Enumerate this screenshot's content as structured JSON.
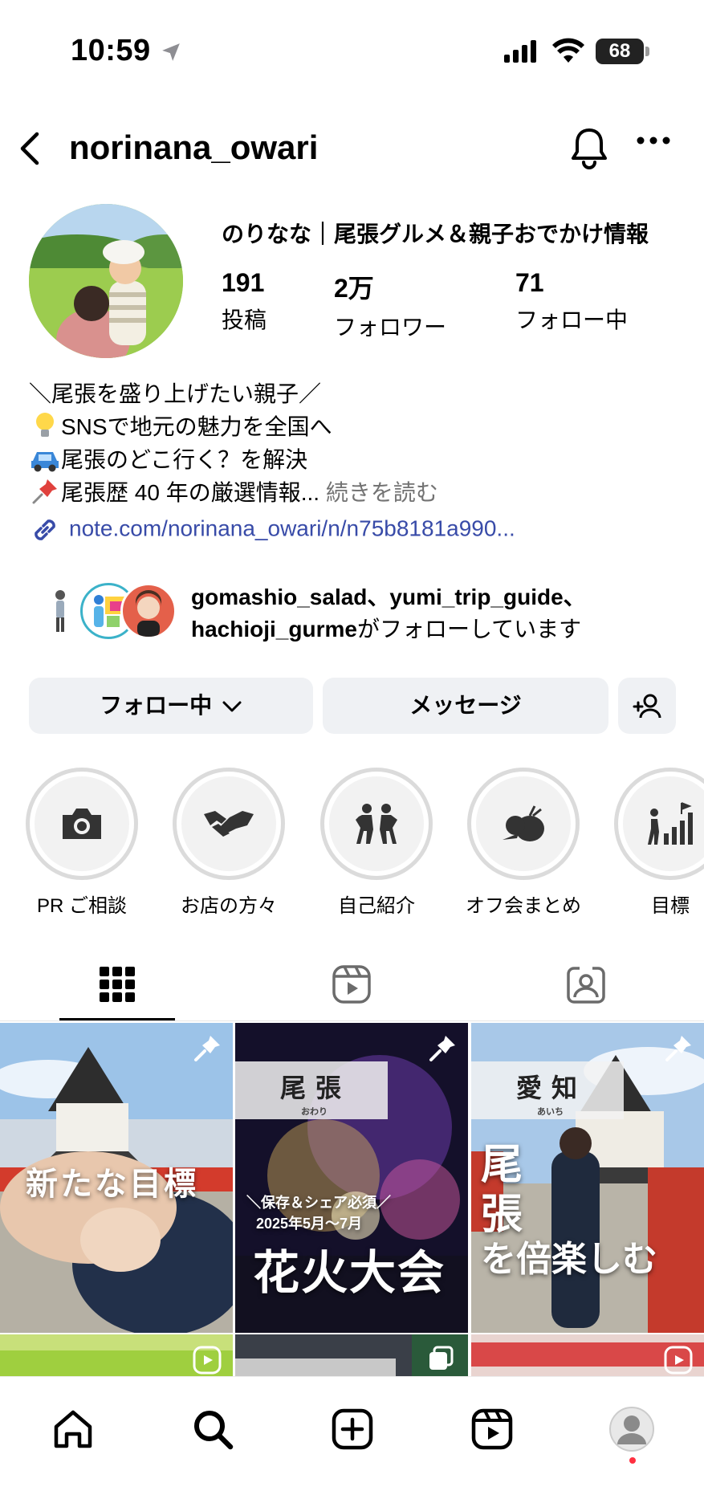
{
  "status_bar": {
    "time": "10:59",
    "battery": "68"
  },
  "header": {
    "username": "norinana_owari"
  },
  "profile": {
    "display_name": "のりなな｜尾張グルメ＆親子おでかけ情報",
    "stats": [
      {
        "value": "191",
        "label": "投稿"
      },
      {
        "value": "2万",
        "label": "フォロワー"
      },
      {
        "value": "71",
        "label": "フォロー中"
      }
    ],
    "bio": {
      "line1": "＼尾張を盛り上げたい親子／",
      "line2": "SNSで地元の魅力を全国へ",
      "line3": "尾張のどこ行く？を解決",
      "line4": "尾張歴 40 年の厳選情報...",
      "more": "続きを読む"
    },
    "link": "note.com/norinana_owari/n/n75b8181a990...",
    "mutual": {
      "names": "gomashio_salad、yumi_trip_guide、",
      "name_last": "hachioji_gurme",
      "suffix": "がフォローしています"
    }
  },
  "buttons": {
    "following": "フォロー中",
    "message": "メッセージ"
  },
  "highlights": [
    {
      "label": "PR ご相談",
      "icon": "camera-icon"
    },
    {
      "label": "お店の方々",
      "icon": "handshake-icon"
    },
    {
      "label": "自己紹介",
      "icon": "people-icon"
    },
    {
      "label": "オフ会まとめ",
      "icon": "vegetables-icon"
    },
    {
      "label": "目標",
      "icon": "growth-icon"
    }
  ],
  "posts": [
    {
      "text": "新たな目標"
    },
    {
      "tag": "尾張",
      "tag_sub": "おわり",
      "sub": "＼保存＆シェア必須／",
      "date": "2025年5月～7月",
      "main": "花火大会"
    },
    {
      "tag": "愛知",
      "tag_sub": "あいち",
      "main1": "尾",
      "main2": "張",
      "main3": "を倍楽しむ"
    }
  ],
  "colors": {
    "link": "#384ba8",
    "button_bg": "#eff1f4",
    "notification_dot": "#ff3040"
  }
}
